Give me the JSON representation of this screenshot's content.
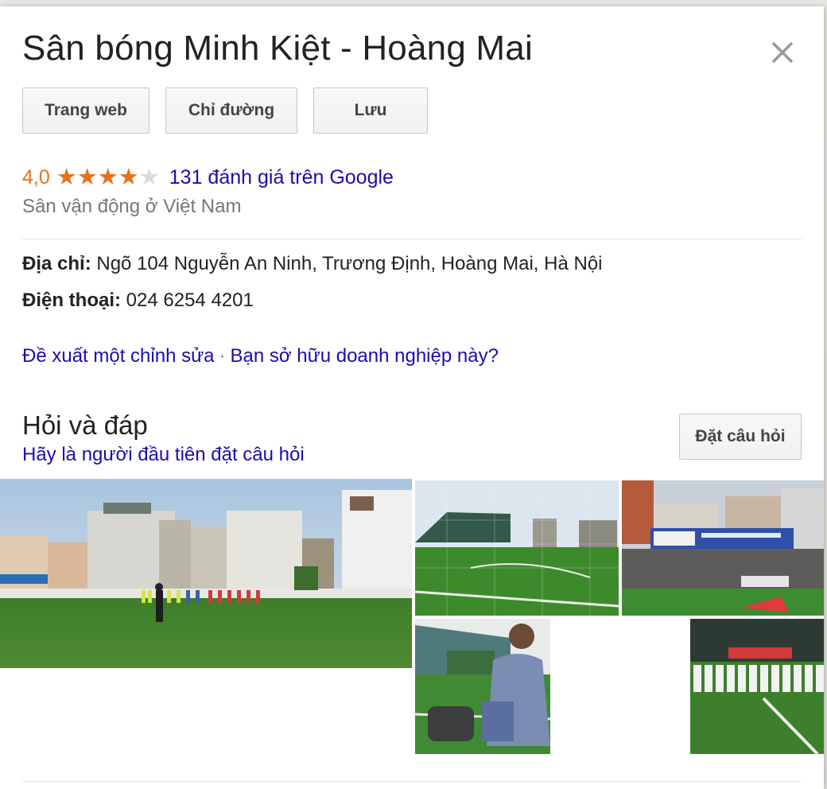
{
  "place": {
    "title": "Sân bóng Minh Kiệt - Hoàng Mai",
    "close_icon": "close-icon"
  },
  "actions": {
    "website_label": "Trang web",
    "directions_label": "Chỉ đường",
    "save_label": "Lưu"
  },
  "rating": {
    "value_text": "4,0",
    "stars": 4,
    "max_stars": 5,
    "reviews_text": "131 đánh giá trên Google",
    "color": "#e7711b"
  },
  "category": "Sân vận động ở Việt Nam",
  "details": {
    "address_label": "Địa chỉ:",
    "address_value": " Ngõ 104 Nguyễn An Ninh, Trương Định, Hoàng Mai, Hà Nội",
    "phone_label": "Điện thoại:",
    "phone_value": " 024 6254 4201"
  },
  "links": {
    "suggest_edit": "Đề xuất một chỉnh sửa",
    "separator": "·",
    "own_business": "Bạn sở hữu doanh nghiệp này?"
  },
  "qa": {
    "title": "Hỏi và đáp",
    "first_question_link": "Hãy là người đầu tiên đặt câu hỏi",
    "ask_button": "Đặt câu hỏi"
  },
  "colors": {
    "link": "#1a0dab",
    "accent": "#e7711b",
    "muted": "#777777"
  }
}
